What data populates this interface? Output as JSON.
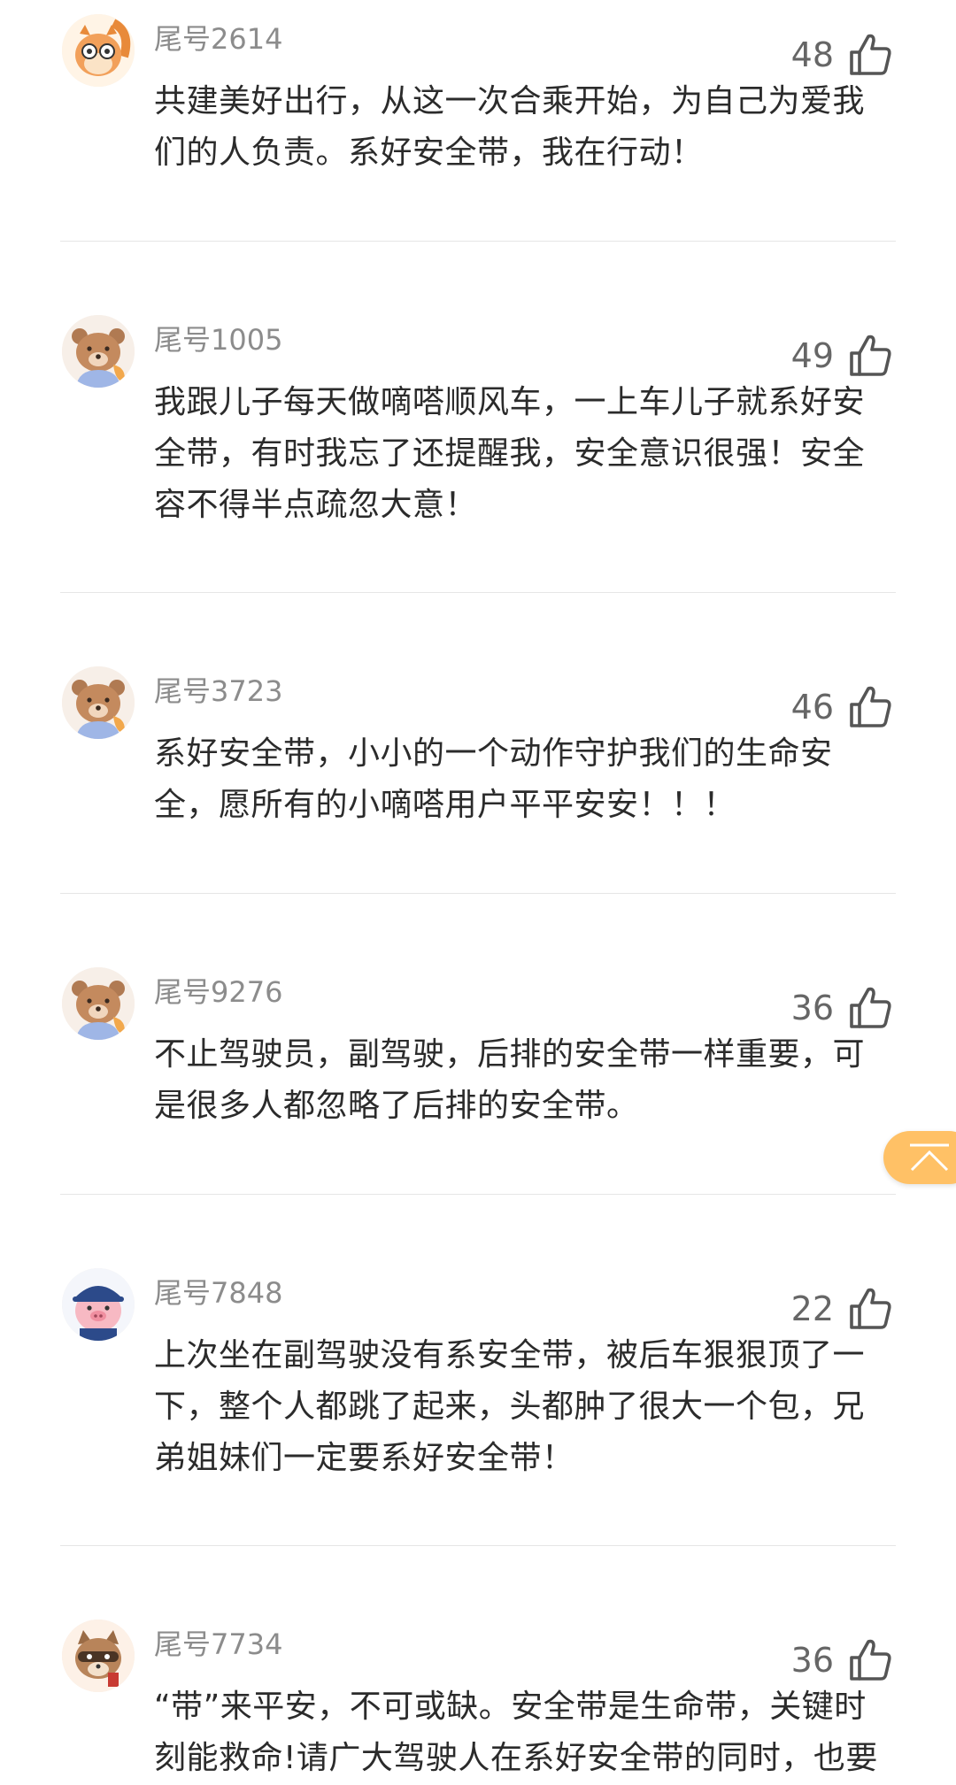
{
  "colors": {
    "username": "#8c8c8c",
    "text": "#2b2b2b",
    "like": "#666666",
    "divider": "#e6e6e6",
    "back_to_top": "#ffc166"
  },
  "comments": [
    {
      "username": "尾号2614",
      "likes": "48",
      "avatar_icon": "squirrel-glasses-avatar",
      "text": "共建美好出行，从这一次合乘开始，为自己为爱我们的人负责。系好安全带，我在行动！"
    },
    {
      "username": "尾号1005",
      "likes": "49",
      "avatar_icon": "bear-avatar",
      "text": "我跟儿子每天做嘀嗒顺风车，一上车儿子就系好安全带，有时我忘了还提醒我，安全意识很强！安全容不得半点疏忽大意！"
    },
    {
      "username": "尾号3723",
      "likes": "46",
      "avatar_icon": "bear-avatar",
      "text": "系好安全带，小小的一个动作守护我们的生命安全，愿所有的小嘀嗒用户平平安安！！！"
    },
    {
      "username": "尾号9276",
      "likes": "36",
      "avatar_icon": "bear-avatar",
      "text": "不止驾驶员，副驾驶，后排的安全带一样重要，可是很多人都忽略了后排的安全带。"
    },
    {
      "username": "尾号7848",
      "likes": "22",
      "avatar_icon": "pig-cap-avatar",
      "text": "上次坐在副驾驶没有系安全带，被后车狠狠顶了一下，整个人都跳了起来，头都肿了很大一个包，兄弟姐妹们一定要系好安全带！"
    },
    {
      "username": "尾号7734",
      "likes": "36",
      "avatar_icon": "raccoon-avatar",
      "text": "“带”来平安，不可或缺。安全带是生命带，关键时刻能救命!请广大驾驶人在系好安全带的同时，也要"
    }
  ],
  "icons": {
    "like": "thumbs-up-icon",
    "back_to_top": "back-to-top-icon"
  }
}
